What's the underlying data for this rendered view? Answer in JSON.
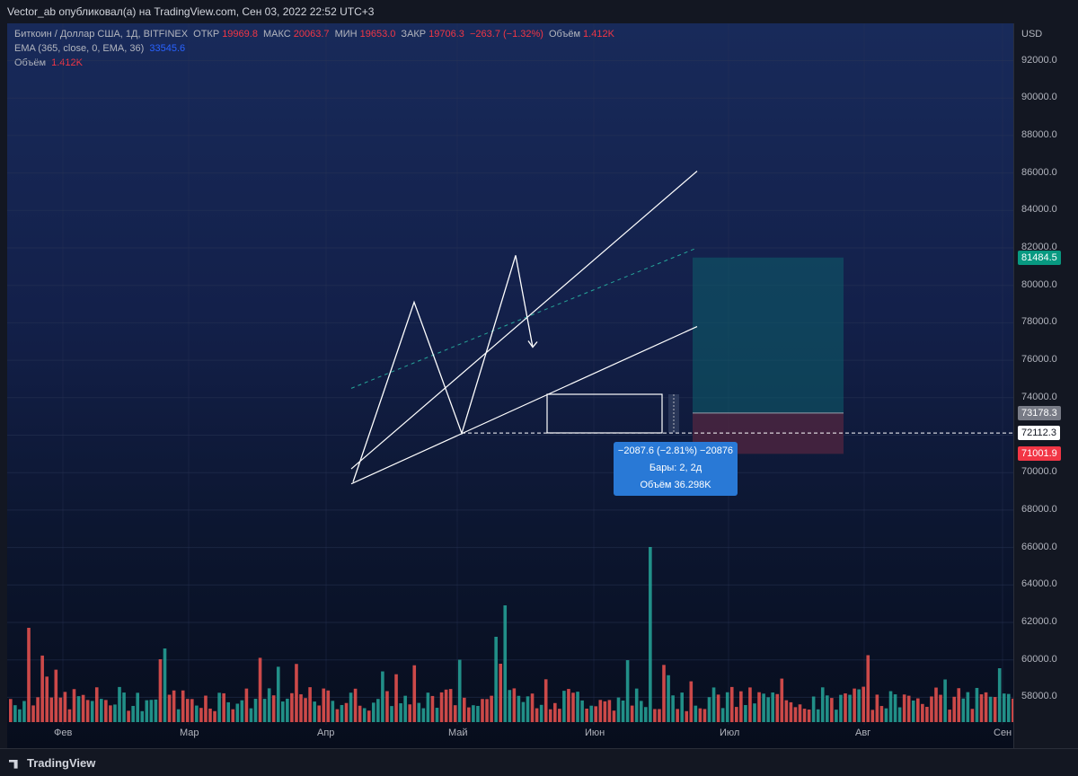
{
  "header": {
    "published_by": "Vector_ab опубликовал(а) на TradingView.com, Сен 03, 2022 22:52 UTC+3"
  },
  "legend": {
    "symbol": "Биткоин / Доллар США, 1Д, BITFINEX",
    "open_label": "ОТКР",
    "open": "19969.8",
    "high_label": "МАКС",
    "high": "20063.7",
    "low_label": "МИН",
    "low": "19653.0",
    "close_label": "ЗАКР",
    "close": "19706.3",
    "change": "−263.7 (−1.32%)",
    "volume_label": "Объём",
    "volume": "1.412K",
    "ema_label": "EMA (365, close, 0, EMA, 36)",
    "ema_value": "33545.6",
    "vol_label": "Объём",
    "vol_value": "1.412K"
  },
  "price_scale": {
    "currency": "USD",
    "ticks": [
      "92000.0",
      "90000.0",
      "88000.0",
      "86000.0",
      "84000.0",
      "82000.0",
      "80000.0",
      "78000.0",
      "76000.0",
      "74000.0",
      "72000.0",
      "70000.0",
      "68000.0",
      "66000.0",
      "64000.0",
      "62000.0",
      "60000.0",
      "58000.0"
    ],
    "tag_target": "81484.5",
    "tag_entry": "73178.3",
    "tag_current": "72112.3",
    "tag_stop": "71001.9"
  },
  "time_scale": {
    "labels": [
      "Фев",
      "Мар",
      "Апр",
      "Май",
      "Июн",
      "Июл",
      "Авг",
      "Сен"
    ]
  },
  "measure": {
    "line1": "−2087.6 (−2.81%) −20876",
    "line2": "Бары: 2, 2д",
    "line3": "Объём 36.298K"
  },
  "branding": {
    "logo_text": "TradingView"
  },
  "colors": {
    "up": "#26a69a",
    "down": "#ef5350",
    "target_zone": "#0d5f6b",
    "stop_zone": "#4a2540",
    "target_tag": "#089981",
    "stop_tag": "#f23645",
    "entry_tag": "#787b86"
  },
  "chart_data": {
    "type": "bar",
    "symbol": "BTC/USD",
    "timeframe": "1D",
    "y_axis": {
      "min": 56000,
      "max": 93000,
      "unit": "USD"
    },
    "x_axis_labels": [
      "Фев",
      "Мар",
      "Апр",
      "Май",
      "Июн",
      "Июл",
      "Авг",
      "Сен"
    ],
    "drawings": {
      "channel_upper": [
        [
          391,
          70200
        ],
        [
          776,
          86100
        ]
      ],
      "channel_lower": [
        [
          391,
          69400
        ],
        [
          776,
          77800
        ]
      ],
      "zigzag": [
        [
          393,
          69500
        ],
        [
          461,
          79100
        ],
        [
          514,
          72100
        ],
        [
          574,
          81600
        ],
        [
          593,
          76700
        ]
      ],
      "long_position": {
        "target": 81484.5,
        "entry": 73178.3,
        "stop": 71001.9
      },
      "current_price_line": 72112.3
    },
    "volume_bars_note": "volume histogram shown at bottom of chart"
  }
}
